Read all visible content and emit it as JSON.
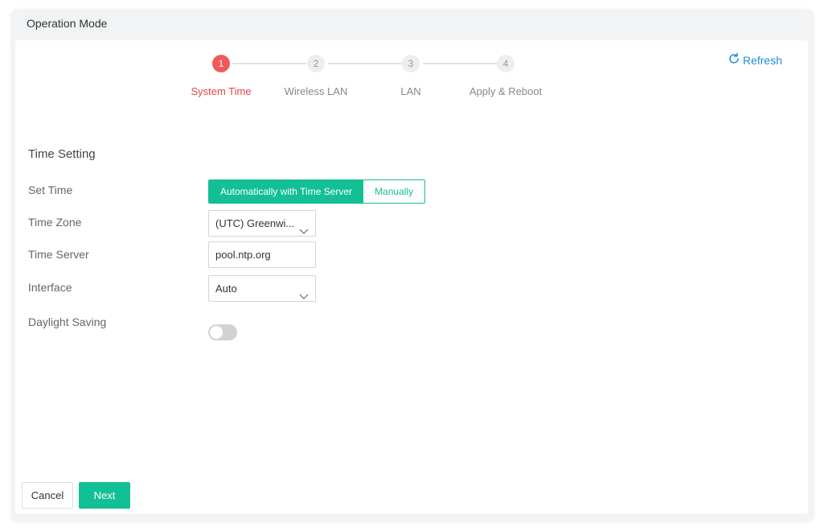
{
  "window": {
    "title": "Operation Mode"
  },
  "toolbar": {
    "refresh_label": "Refresh"
  },
  "stepper": {
    "steps": [
      {
        "number": "1",
        "label": "System Time",
        "active": true
      },
      {
        "number": "2",
        "label": "Wireless LAN",
        "active": false
      },
      {
        "number": "3",
        "label": "LAN",
        "active": false
      },
      {
        "number": "4",
        "label": "Apply & Reboot",
        "active": false
      }
    ]
  },
  "form": {
    "section_title": "Time Setting",
    "set_time": {
      "label": "Set Time",
      "options": [
        "Automatically with Time Server",
        "Manually"
      ],
      "selected": "Automatically with Time Server"
    },
    "time_zone": {
      "label": "Time Zone",
      "value": "(UTC) Greenwi..."
    },
    "time_server": {
      "label": "Time Server",
      "value": "pool.ntp.org"
    },
    "interface": {
      "label": "Interface",
      "value": "Auto"
    },
    "daylight_saving": {
      "label": "Daylight Saving",
      "enabled": false
    }
  },
  "footer": {
    "cancel_label": "Cancel",
    "next_label": "Next"
  },
  "colors": {
    "accent": "#13bf95",
    "active_step": "#f05a5a",
    "link": "#1a8fd8"
  }
}
